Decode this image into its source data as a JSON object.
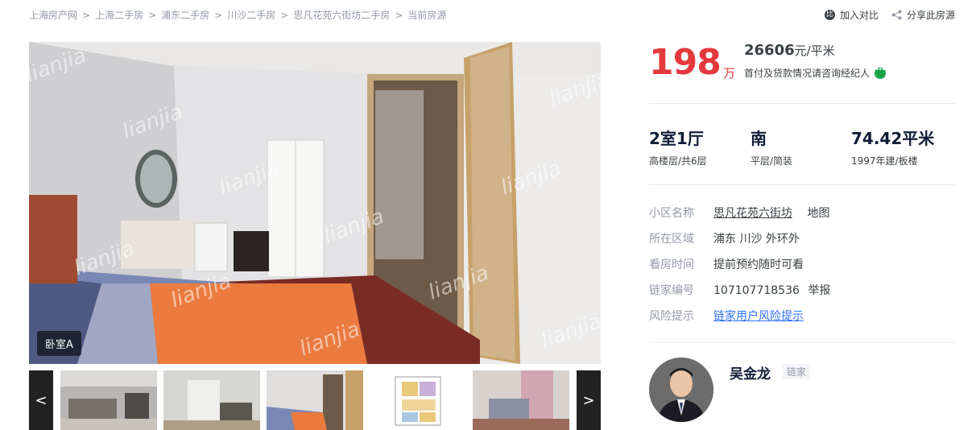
{
  "breadcrumb": {
    "items": [
      "上海房产网",
      "上海二手房",
      "浦东二手房",
      "川沙二手房",
      "思凡花苑六街坊二手房"
    ],
    "separator": ">",
    "current": "当前房源"
  },
  "actions": {
    "compare_label": "加入对比",
    "share_label": "分享此房源"
  },
  "gallery": {
    "caption": "卧室A",
    "watermark": "lianjia",
    "prev_label": "<",
    "next_label": ">",
    "thumbnails": [
      "living-room",
      "living-room-2",
      "bedroom",
      "floor-plan",
      "bedroom-2"
    ]
  },
  "price": {
    "total": "198",
    "total_unit": "万",
    "unit_price": "26606",
    "unit_price_unit": "元/平米",
    "consult_text": "首付及贷款情况请咨询经纪人",
    "accent_color": "#e4393c"
  },
  "specs": {
    "layout": "2室1厅",
    "layout_sub": "高楼层/共6层",
    "orientation": "南",
    "orientation_sub": "平层/简装",
    "area": "74.42平米",
    "area_sub": "1997年建/板楼"
  },
  "info": {
    "community_label": "小区名称",
    "community_value": "思凡花苑六街坊",
    "map_label": "地图",
    "region_label": "所在区域",
    "region_value": "浦东 川沙 外环外",
    "viewing_label": "看房时间",
    "viewing_value": "提前预约随时可看",
    "id_label": "链家编号",
    "id_value": "107107718536",
    "report_label": "举报",
    "risk_label": "风险提示",
    "risk_link": "链家用户风险提示"
  },
  "agent": {
    "name": "吴金龙",
    "tag": "链家"
  }
}
